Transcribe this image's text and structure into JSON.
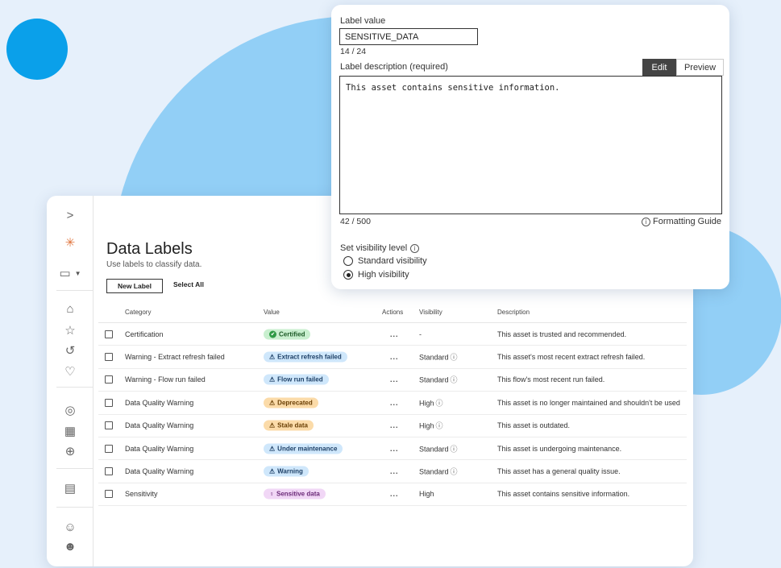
{
  "sidebar": {
    "expand_glyph": ">",
    "items": [
      {
        "name": "logo-icon",
        "glyph": "✳"
      },
      {
        "name": "calendar-icon",
        "glyph": "▭"
      },
      {
        "name": "home-icon",
        "glyph": "⌂"
      },
      {
        "name": "star-icon",
        "glyph": "☆"
      },
      {
        "name": "history-icon",
        "glyph": "↺"
      },
      {
        "name": "lightbulb-icon",
        "glyph": "♡"
      },
      {
        "name": "user-icon",
        "glyph": "◎"
      },
      {
        "name": "grid-icon",
        "glyph": "▦"
      },
      {
        "name": "compass-icon",
        "glyph": "⊕"
      },
      {
        "name": "archive-icon",
        "glyph": "▤"
      },
      {
        "name": "users-icon",
        "glyph": "☺"
      },
      {
        "name": "groups-icon",
        "glyph": "☻"
      }
    ]
  },
  "page": {
    "title": "Data Labels",
    "subtitle": "Use labels to classify data.",
    "new_label_button": "New Label",
    "select_all_button": "Select All"
  },
  "table": {
    "headers": {
      "category": "Category",
      "value": "Value",
      "actions": "Actions",
      "visibility": "Visibility",
      "description": "Description"
    },
    "rows": [
      {
        "category": "Certification",
        "value": "Certified",
        "pill": "green",
        "icon": "✔",
        "visibility": "-",
        "vis_info": false,
        "description": "This asset is trusted and recommended."
      },
      {
        "category": "Warning - Extract refresh failed",
        "value": "Extract refresh failed",
        "pill": "blue",
        "icon": "⚠",
        "visibility": "Standard",
        "vis_info": true,
        "description": "This asset's most recent extract refresh failed."
      },
      {
        "category": "Warning - Flow run failed",
        "value": "Flow run failed",
        "pill": "blue",
        "icon": "⚠",
        "visibility": "Standard",
        "vis_info": true,
        "description": "This flow's most recent run failed."
      },
      {
        "category": "Data Quality Warning",
        "value": "Deprecated",
        "pill": "orange",
        "icon": "⚠",
        "visibility": "High",
        "vis_info": true,
        "description": "This asset is no longer maintained and shouldn't be used"
      },
      {
        "category": "Data Quality Warning",
        "value": "Stale data",
        "pill": "orange",
        "icon": "⚠",
        "visibility": "High",
        "vis_info": true,
        "description": "This asset is outdated."
      },
      {
        "category": "Data Quality Warning",
        "value": "Under maintenance",
        "pill": "blue",
        "icon": "⚠",
        "visibility": "Standard",
        "vis_info": true,
        "description": "This asset is undergoing maintenance."
      },
      {
        "category": "Data Quality Warning",
        "value": "Warning",
        "pill": "blue",
        "icon": "⚠",
        "visibility": "Standard",
        "vis_info": true,
        "description": "This asset has a general quality issue."
      },
      {
        "category": "Sensitivity",
        "value": "Sensitive data",
        "pill": "pink",
        "icon": "♀",
        "visibility": "High",
        "vis_info": false,
        "description": "This asset contains sensitive information."
      }
    ],
    "actions_glyph": "..."
  },
  "edit_panel": {
    "label_value_label": "Label value",
    "label_value": "SENSITIVE_DATA",
    "label_value_count": "14 / 24",
    "description_label": "Label description (required)",
    "tab_edit": "Edit",
    "tab_preview": "Preview",
    "description_value": "This asset contains sensitive information.",
    "description_count": "42 / 500",
    "formatting_guide": "Formatting Guide",
    "visibility_label": "Set visibility level",
    "options": [
      "Standard visibility",
      "High visibility"
    ],
    "selected_option": 1
  }
}
